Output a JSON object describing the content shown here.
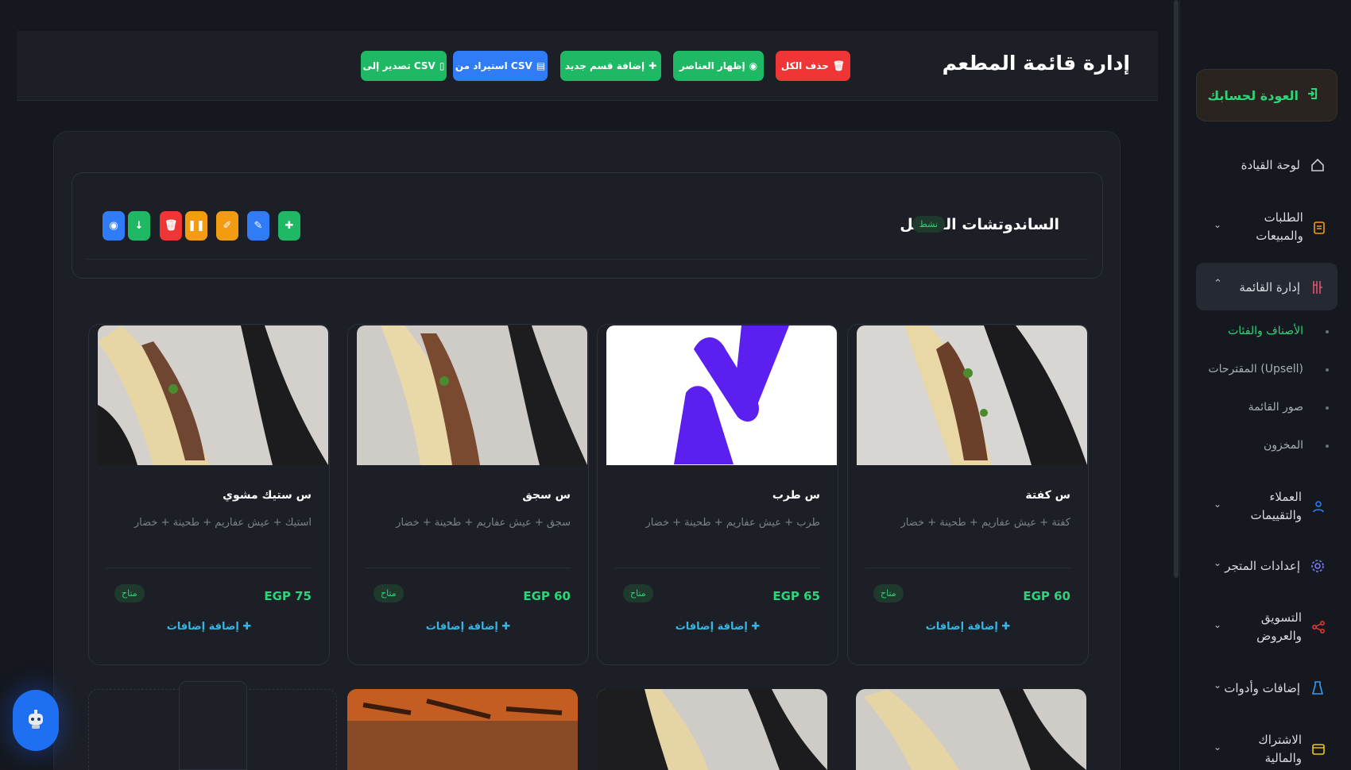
{
  "header": {
    "title": "إدارة قائمة المطعم",
    "buttons": {
      "delete_all": "حذف الكل",
      "show_items": "إظهار العناصر",
      "add_category": "إضافة قسم جديد",
      "import_csv": "استيراد من CSV",
      "export_csv": "تصدير إلى CSV"
    }
  },
  "sidebar": {
    "back": "العودة لحسابك",
    "items": {
      "dashboard": "لوحة القيادة",
      "orders": "الطلبات والمبيعات",
      "menu": "إدارة القائمة",
      "customers": "العملاء والتقييمات",
      "store": "إعدادات المتجر",
      "marketing": "التسويق والعروض",
      "addons": "إضافات وأدوات",
      "subscription": "الاشتراك والمالية"
    },
    "subitems": {
      "categories": "الأصناف والفئات",
      "upsell": "المقترحات (Upsell)",
      "menu_images": "صور القائمة",
      "inventory": "المخزون"
    }
  },
  "category": {
    "title": "الساندوتشات السنجل",
    "status": "نشط"
  },
  "items": [
    {
      "name": "س كفتة",
      "desc": "كفتة + عيش عفاريم + طحينة + خضار",
      "price": "EGP 60",
      "status": "متاح",
      "addon": "إضافة إضافات"
    },
    {
      "name": "س طرب",
      "desc": "طرب + عيش عفاريم + طحينة + خضار",
      "price": "EGP 65",
      "status": "متاح",
      "addon": "إضافة إضافات"
    },
    {
      "name": "س سجق",
      "desc": "سجق + عيش عفاريم + طحينة + خضار",
      "price": "EGP 60",
      "status": "متاح",
      "addon": "إضافة إضافات"
    },
    {
      "name": "س ستيك مشوي",
      "desc": "استيك + عيش عفاريم + طحينة + خضار",
      "price": "EGP 75",
      "status": "متاح",
      "addon": "إضافة إضافات"
    }
  ],
  "colors": {
    "accent": "#2ed47a",
    "danger": "#ef3535",
    "primary": "#2f7cf6",
    "warning": "#f39c12"
  }
}
